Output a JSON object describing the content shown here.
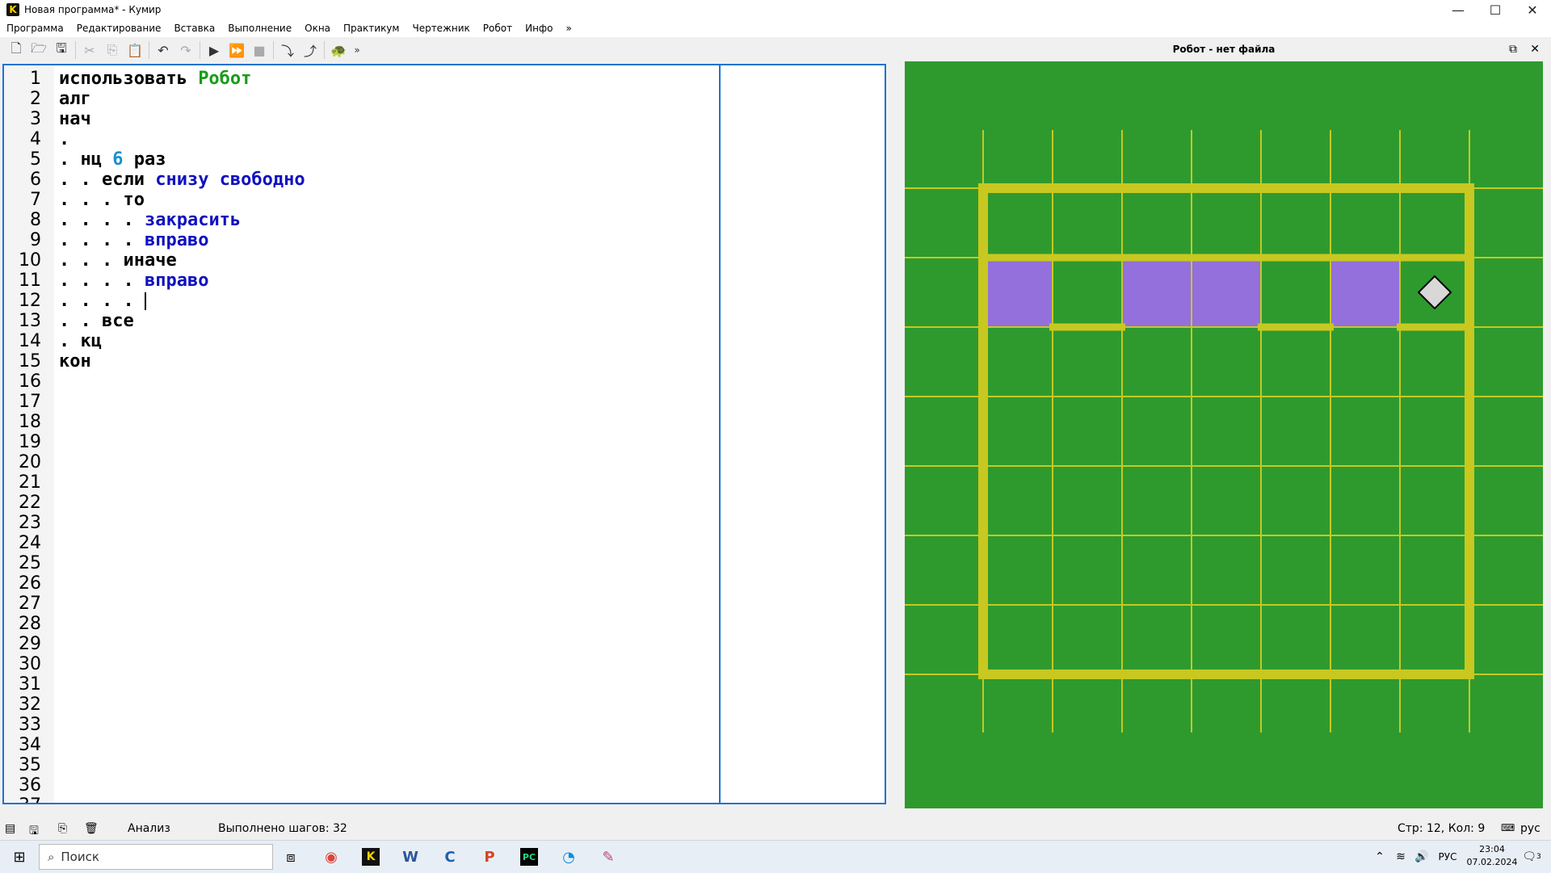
{
  "window": {
    "title": "Новая программа* - Кумир",
    "app_icon": "K"
  },
  "menu": [
    "Программа",
    "Редактирование",
    "Вставка",
    "Выполнение",
    "Окна",
    "Практикум",
    "Чертежник",
    "Робот",
    "Инфо",
    "»"
  ],
  "toolbar": {
    "icons": [
      "new-file-icon",
      "open-folder-icon",
      "save-icon",
      "cut-icon",
      "copy-icon",
      "paste-icon",
      "undo-icon",
      "redo-icon",
      "run-icon",
      "step-run-icon",
      "stop-icon",
      "step-into-icon",
      "step-out-icon",
      "turtle-icon",
      "more-icon"
    ],
    "more": "»"
  },
  "editor": {
    "lines": [
      {
        "n": "1",
        "parts": [
          {
            "t": "использовать ",
            "c": "default"
          },
          {
            "t": "Робот",
            "c": "green"
          }
        ]
      },
      {
        "n": "2",
        "parts": [
          {
            "t": "алг",
            "c": "default"
          }
        ]
      },
      {
        "n": "3",
        "parts": [
          {
            "t": "нач",
            "c": "default"
          }
        ]
      },
      {
        "n": "4",
        "parts": [
          {
            "t": ".",
            "c": "default"
          }
        ]
      },
      {
        "n": "5",
        "parts": [
          {
            "t": ". нц ",
            "c": "default"
          },
          {
            "t": "6",
            "c": "number"
          },
          {
            "t": " раз",
            "c": "default"
          }
        ]
      },
      {
        "n": "6",
        "parts": [
          {
            "t": ". . если ",
            "c": "default"
          },
          {
            "t": "снизу свободно",
            "c": "blue"
          }
        ]
      },
      {
        "n": "7",
        "parts": [
          {
            "t": ". . . то",
            "c": "default"
          }
        ]
      },
      {
        "n": "8",
        "parts": [
          {
            "t": ". . . . ",
            "c": "default"
          },
          {
            "t": "закрасить",
            "c": "blue"
          }
        ]
      },
      {
        "n": "9",
        "parts": [
          {
            "t": ". . . . ",
            "c": "default"
          },
          {
            "t": "вправо",
            "c": "blue"
          }
        ]
      },
      {
        "n": "10",
        "parts": [
          {
            "t": ". . . иначе",
            "c": "default"
          }
        ]
      },
      {
        "n": "11",
        "parts": [
          {
            "t": ". . . . ",
            "c": "default"
          },
          {
            "t": "вправо",
            "c": "blue"
          }
        ]
      },
      {
        "n": "12",
        "parts": [
          {
            "t": ". . . . ",
            "c": "default"
          }
        ],
        "caret": true
      },
      {
        "n": "13",
        "parts": [
          {
            "t": ". . все",
            "c": "default"
          }
        ]
      },
      {
        "n": "14",
        "parts": [
          {
            "t": ". кц",
            "c": "default"
          }
        ]
      },
      {
        "n": "15",
        "parts": [
          {
            "t": "кон",
            "c": "default"
          }
        ]
      },
      {
        "n": "16",
        "parts": []
      },
      {
        "n": "17",
        "parts": []
      },
      {
        "n": "18",
        "parts": []
      },
      {
        "n": "19",
        "parts": []
      },
      {
        "n": "20",
        "parts": []
      },
      {
        "n": "21",
        "parts": []
      },
      {
        "n": "22",
        "parts": []
      },
      {
        "n": "23",
        "parts": []
      },
      {
        "n": "24",
        "parts": []
      },
      {
        "n": "25",
        "parts": []
      },
      {
        "n": "26",
        "parts": []
      },
      {
        "n": "27",
        "parts": []
      },
      {
        "n": "28",
        "parts": []
      },
      {
        "n": "29",
        "parts": []
      },
      {
        "n": "30",
        "parts": []
      },
      {
        "n": "31",
        "parts": []
      },
      {
        "n": "32",
        "parts": []
      },
      {
        "n": "33",
        "parts": []
      },
      {
        "n": "34",
        "parts": []
      },
      {
        "n": "35",
        "parts": []
      },
      {
        "n": "36",
        "parts": []
      },
      {
        "n": "37",
        "parts": []
      }
    ]
  },
  "robot": {
    "title": "Робот - нет файла",
    "controls": [
      "undock-icon",
      "close-icon"
    ],
    "close_glyph": "✕",
    "colors": {
      "field": "#2e9a2e",
      "grid": "#c8c820",
      "wall": "#c8c820",
      "painted": "#9370db",
      "robot": "#d8d8d8"
    },
    "grid_cols": 7,
    "grid_rows": 7,
    "painted_cells": [
      [
        0,
        1
      ],
      [
        2,
        1
      ],
      [
        3,
        1
      ],
      [
        5,
        1
      ]
    ],
    "walls_below_cells": [
      [
        1,
        1
      ],
      [
        4,
        1
      ],
      [
        6,
        1
      ]
    ],
    "robot_cell": [
      6,
      1
    ]
  },
  "status": {
    "analysis": "Анализ",
    "steps": "Выполнено шагов: 32",
    "position": "Стр: 12, Кол: 9",
    "lang": "рус"
  },
  "taskbar": {
    "search_placeholder": "Поиск",
    "apps": [
      "windows-start-icon",
      "search-icon",
      "task-view-icon",
      "chrome-icon",
      "kumir-icon",
      "word-icon",
      "c-icon",
      "powerpoint-icon",
      "pycharm-icon",
      "edge-icon",
      "paint-icon"
    ],
    "lang": "РУС",
    "time": "23:04",
    "date": "07.02.2024",
    "notifications": "3"
  }
}
